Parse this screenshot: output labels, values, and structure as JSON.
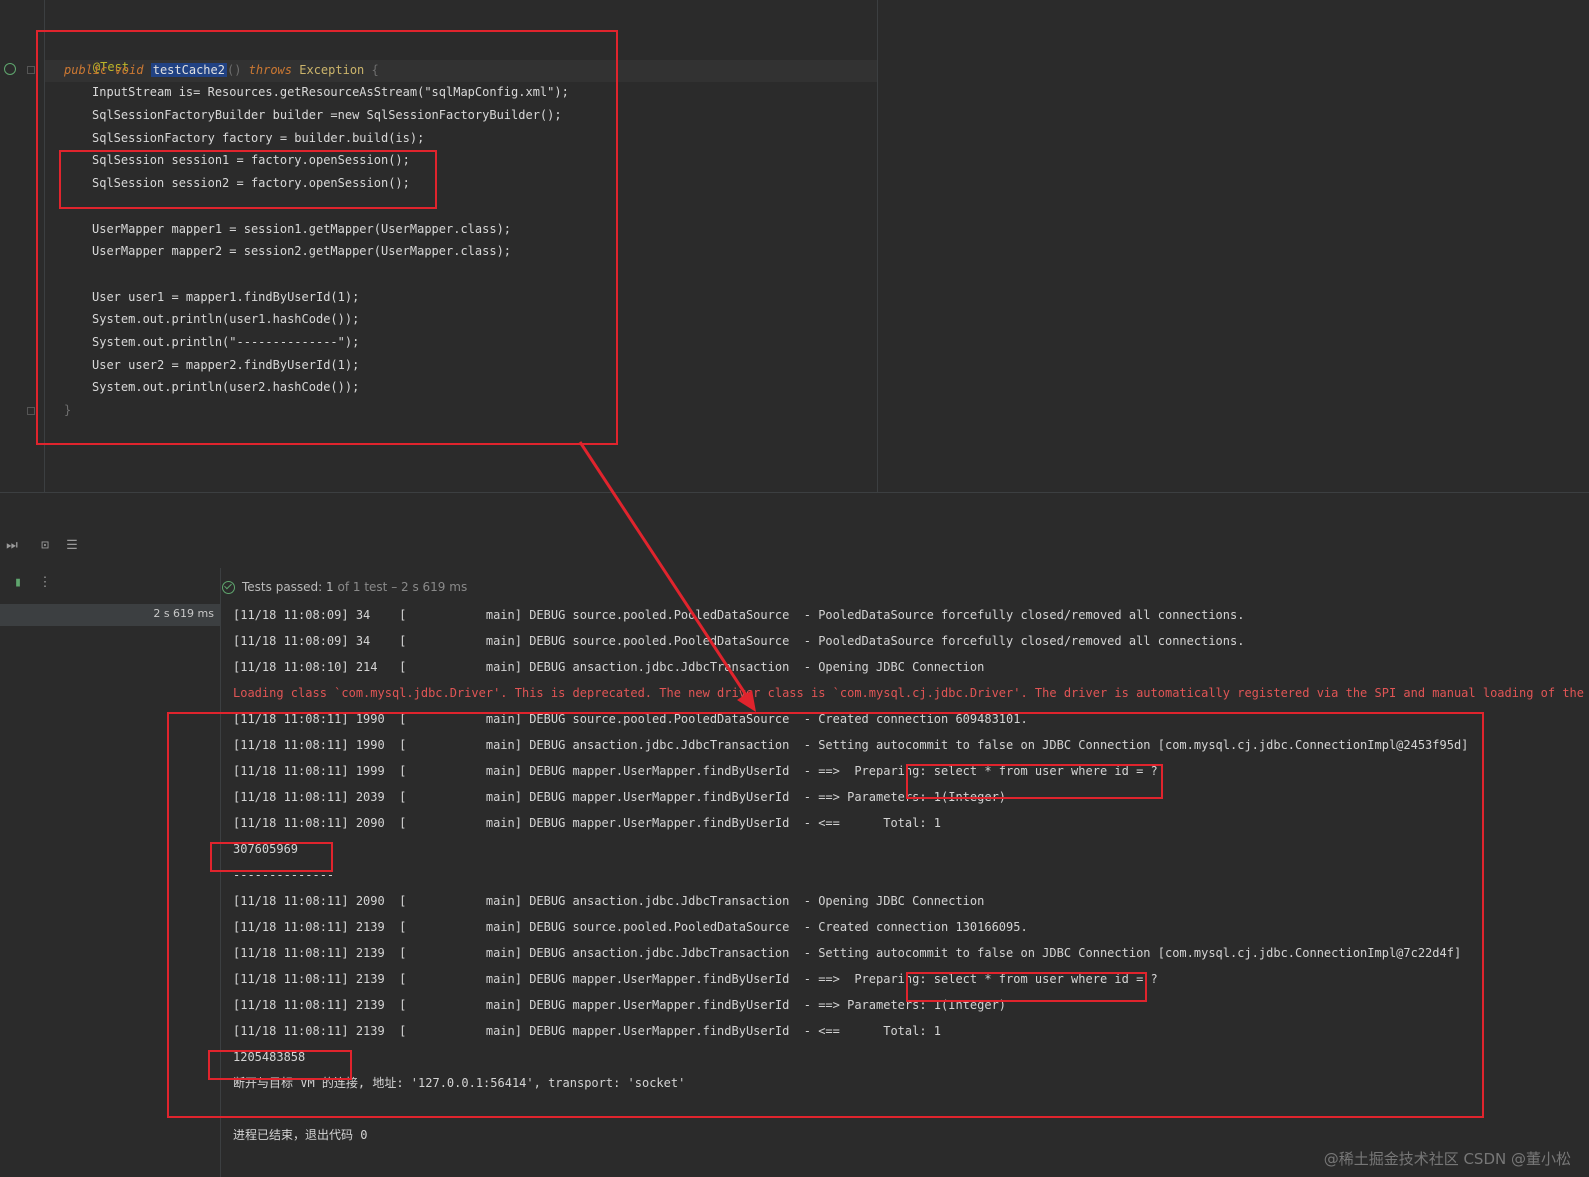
{
  "editor": {
    "lines": [
      {
        "k": "annotation",
        "t": "@Test"
      },
      {
        "k": "signature",
        "mod": "public void",
        "name": "testCache2",
        "throws": "throws",
        "exc": "Exception",
        "brace": "{"
      },
      {
        "k": "text",
        "t": "InputStream is= Resources.getResourceAsStream(\"sqlMapConfig.xml\");"
      },
      {
        "k": "text",
        "t": "SqlSessionFactoryBuilder builder =new SqlSessionFactoryBuilder();"
      },
      {
        "k": "text",
        "t": "SqlSessionFactory factory = builder.build(is);"
      },
      {
        "k": "text",
        "t": "SqlSession session1 = factory.openSession();"
      },
      {
        "k": "text",
        "t": "SqlSession session2 = factory.openSession();"
      },
      {
        "k": "text",
        "t": "UserMapper mapper1 = session1.getMapper(UserMapper.class);"
      },
      {
        "k": "text",
        "t": "UserMapper mapper2 = session2.getMapper(UserMapper.class);"
      },
      {
        "k": "text",
        "t": "User user1 = mapper1.findByUserId(1);"
      },
      {
        "k": "text",
        "t": "System.out.println(user1.hashCode());"
      },
      {
        "k": "text",
        "t": "System.out.println(\"--------------\");"
      },
      {
        "k": "text",
        "t": "User user2 = mapper2.findByUserId(1);"
      },
      {
        "k": "text",
        "t": "System.out.println(user2.hashCode());"
      },
      {
        "k": "text",
        "t": "}"
      }
    ]
  },
  "run_panel": {
    "status_passed": "Tests passed:",
    "status_count": "1",
    "status_rest": "of 1 test – 2 s 619 ms",
    "tree_time": "2 s 619 ms"
  },
  "console": [
    "[11/18 11:08:09] 34    [           main] DEBUG source.pooled.PooledDataSource  - PooledDataSource forcefully closed/removed all connections.",
    "[11/18 11:08:09] 34    [           main] DEBUG source.pooled.PooledDataSource  - PooledDataSource forcefully closed/removed all connections.",
    "[11/18 11:08:10] 214   [           main] DEBUG ansaction.jdbc.JdbcTransaction  - Opening JDBC Connection",
    "Loading class `com.mysql.jdbc.Driver'. This is deprecated. The new driver class is `com.mysql.cj.jdbc.Driver'. The driver is automatically registered via the SPI and manual loading of the driver",
    "[11/18 11:08:11] 1990  [           main] DEBUG source.pooled.PooledDataSource  - Created connection 609483101.",
    "[11/18 11:08:11] 1990  [           main] DEBUG ansaction.jdbc.JdbcTransaction  - Setting autocommit to false on JDBC Connection [com.mysql.cj.jdbc.ConnectionImpl@2453f95d]",
    "[11/18 11:08:11] 1999  [           main] DEBUG mapper.UserMapper.findByUserId  - ==>  Preparing: select * from user where id = ?",
    "[11/18 11:08:11] 2039  [           main] DEBUG mapper.UserMapper.findByUserId  - ==> Parameters: 1(Integer)",
    "[11/18 11:08:11] 2090  [           main] DEBUG mapper.UserMapper.findByUserId  - <==      Total: 1",
    "307605969",
    "--------------",
    "[11/18 11:08:11] 2090  [           main] DEBUG ansaction.jdbc.JdbcTransaction  - Opening JDBC Connection",
    "[11/18 11:08:11] 2139  [           main] DEBUG source.pooled.PooledDataSource  - Created connection 130166095.",
    "[11/18 11:08:11] 2139  [           main] DEBUG ansaction.jdbc.JdbcTransaction  - Setting autocommit to false on JDBC Connection [com.mysql.cj.jdbc.ConnectionImpl@7c22d4f]",
    "[11/18 11:08:11] 2139  [           main] DEBUG mapper.UserMapper.findByUserId  - ==>  Preparing: select * from user where id = ?",
    "[11/18 11:08:11] 2139  [           main] DEBUG mapper.UserMapper.findByUserId  - ==> Parameters: 1(Integer)",
    "[11/18 11:08:11] 2139  [           main] DEBUG mapper.UserMapper.findByUserId  - <==      Total: 1",
    "1205483858",
    "断开与目标 VM 的连接, 地址: '127.0.0.1:56414', transport: 'socket'",
    "",
    "进程已结束，退出代码 0"
  ],
  "watermark": "@稀土掘金技术社区 CSDN @董小松",
  "colors": {
    "annotation_box": "#e0242d",
    "pass_green": "#5fa66e",
    "error_red": "#e05555"
  }
}
